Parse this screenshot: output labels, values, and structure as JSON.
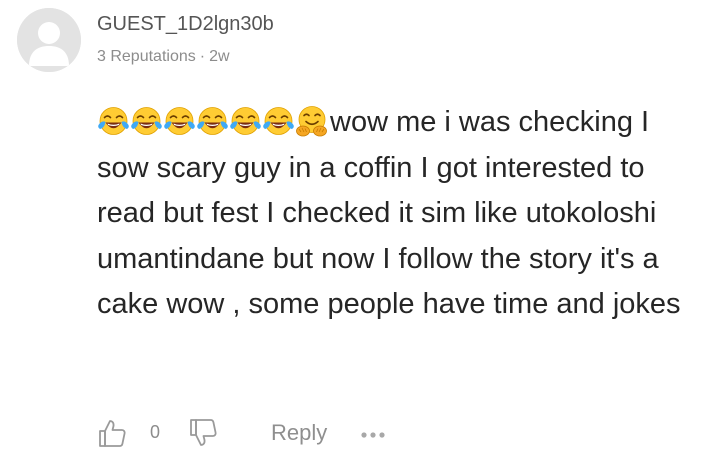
{
  "comment": {
    "username": "GUEST_1D2lgn30b",
    "reputation": "3 Reputations",
    "separator": "·",
    "time_ago": "2w",
    "emojis": [
      "face-with-tears-of-joy-icon",
      "face-with-tears-of-joy-icon",
      "face-with-tears-of-joy-icon",
      "face-with-tears-of-joy-icon",
      "face-with-tears-of-joy-icon",
      "face-with-tears-of-joy-icon",
      "hugging-face-icon"
    ],
    "text": "wow me i was checking I sow scary guy in a coffin I got interested to read but fest I checked it sim like utokoloshi umantindane but now I follow the story it's a cake wow , some people have time and jokes",
    "like_count": "0",
    "reply_label": "Reply"
  },
  "colors": {
    "text": "#262626",
    "meta": "#8c8c8c",
    "icon": "#9a9a9a",
    "avatar_bg": "#e3e3e3"
  }
}
